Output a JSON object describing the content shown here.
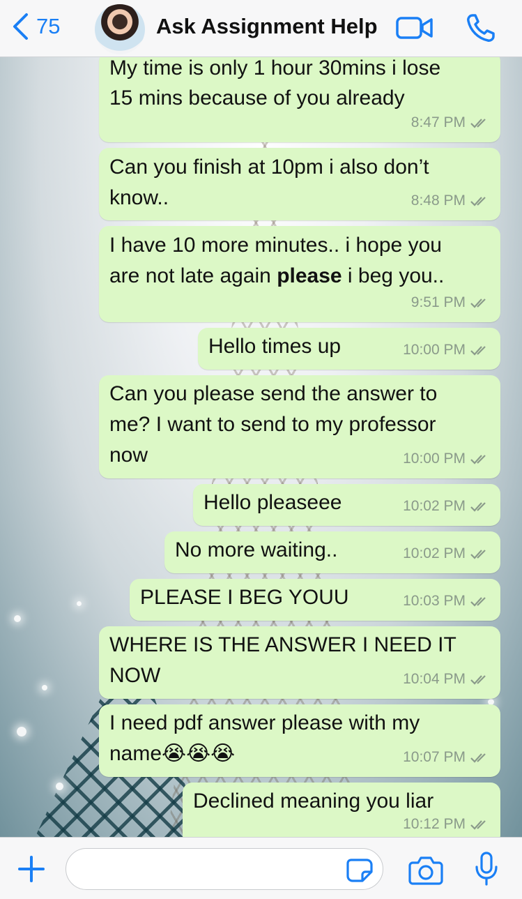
{
  "header": {
    "back_count": "75",
    "title": "Ask Assignment Help"
  },
  "colors": {
    "accent": "#1a7ff5",
    "bubble_outgoing": "#dcf8c6",
    "meta_text": "#8a9a8a"
  },
  "messages": [
    {
      "lines": [
        "My time is only 1 hour 30mins i lose",
        "15 mins because of you already"
      ],
      "time": "8:47 PM",
      "status": "read-ticks"
    },
    {
      "lines": [
        "Can you finish at 10pm i also don’t",
        "know.."
      ],
      "time": "8:48 PM",
      "status": "read-ticks"
    },
    {
      "lines": [
        "I have 10 more minutes.. i hope you",
        "are not late again ",
        "please",
        " i beg you.."
      ],
      "time": "9:51 PM",
      "status": "read-ticks"
    },
    {
      "lines": [
        "Hello times up"
      ],
      "time": "10:00 PM",
      "status": "read-ticks"
    },
    {
      "lines": [
        "Can you please send the answer to",
        "me? I want to send to my professor",
        "now"
      ],
      "time": "10:00 PM",
      "status": "read-ticks"
    },
    {
      "lines": [
        "Hello pleaseee"
      ],
      "time": "10:02 PM",
      "status": "read-ticks"
    },
    {
      "lines": [
        "No more waiting.."
      ],
      "time": "10:02 PM",
      "status": "read-ticks"
    },
    {
      "lines": [
        "PLEASE I BEG YOUU"
      ],
      "time": "10:03 PM",
      "status": "read-ticks"
    },
    {
      "lines": [
        "WHERE IS THE ANSWER I NEED IT",
        "NOW"
      ],
      "time": "10:04 PM",
      "status": "read-ticks"
    },
    {
      "lines": [
        "I need pdf answer please with my",
        "name😭😭😭"
      ],
      "time": "10:07 PM",
      "status": "read-ticks"
    },
    {
      "lines": [
        "Declined meaning you liar"
      ],
      "time": "10:12 PM",
      "status": "read-ticks"
    }
  ],
  "composer": {
    "placeholder": "",
    "icons": [
      "plus-icon",
      "sticker-icon",
      "camera-icon",
      "microphone-icon"
    ]
  }
}
